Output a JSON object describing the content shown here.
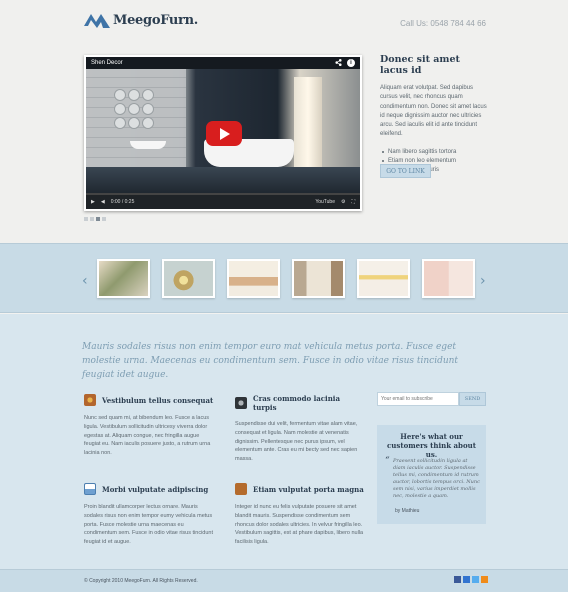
{
  "header": {
    "brand": "MeegoFurn.",
    "call_label": "Call Us:",
    "phone": "0548 784 44 66"
  },
  "video": {
    "title": "Shen Decor",
    "time_current": "0:00",
    "time_total": "0:25",
    "progress": 0,
    "controls": {
      "play": "▶",
      "volume": "◀",
      "youtube": "YouTube",
      "settings": "⚙",
      "fullscreen": "⛶",
      "share": "share-icon",
      "info": "i"
    }
  },
  "slider": {
    "total": 4,
    "active": 2
  },
  "intro": {
    "title": "Donec sit amet lacus id",
    "text": "Aliquam erat volutpat. Sed dapibus cursus velit, nec rhoncus quam condimentum non. Donec sit amet lacus id neque dignissim auctor nec ultricies arcu. Sed iaculis elit id ante tincidunt eleifend.",
    "bullets": [
      "Nam libero sagittis tortora",
      "Etiam non leo elementum",
      "Curabitur at mauris"
    ],
    "button": "GO TO LINK"
  },
  "gallery": {
    "prev": "‹",
    "next": "›",
    "thumbs": [
      "thumb-1",
      "thumb-2",
      "thumb-3",
      "thumb-4",
      "thumb-5",
      "thumb-6"
    ]
  },
  "quote": "Mauris sodales risus non enim tempor euro mat vehicula metus porta. Fusce eget molestie urna. Maecenas eu condimentum sem. Fusce in odio vitae risus tincidunt feugiat idet augue.",
  "features": [
    {
      "title": "Vestibulum tellus consequat",
      "text": "Nunc sed quam mi, at bibendum leo. Fusce a lacus ligula. Vestibulum sollicitudin ultricesy viverra dolor egestas at. Aliquam congue, nec fringilla augue feugiat eu. Nam iaculis posuere justo, a rutrum urna lacinia non.",
      "icon": "palette-icon"
    },
    {
      "title": "Cras commodo lacinia turpis",
      "text": "Suspendisse dui velit, fermentum vitae alam vitae, consequat et ligula. Nam molestie at venenatis dignissim. Pellentesque nec purus ipsum, vel elementum ante. Cras eu mi becty sed nec sapien massa.",
      "icon": "camera-icon"
    },
    {
      "title": "Morbi vulputate adipiscing",
      "text": "Proin blandit ullamcorper lectus ornare. Mauris sodales risus non enim tempor eumy vehicula metus porta. Fusce molestie urna maecenas eu condimentum sem. Fusce in odio vitae risus tincidunt feugiat id et augue.",
      "icon": "document-icon"
    },
    {
      "title": "Etiam vulputat porta magna",
      "text": "Integer id nunc eu felis vulputate posuere sit amet blandit mauris. Suspendisse condimentum sem rhoncus dolor sodales ultricies. In velvur fringilla leo. Vestibulum sagittis, est at phare dapibus, libero nulla facilisis ligula.",
      "icon": "briefcase-icon"
    }
  ],
  "newsletter": {
    "placeholder": "Your email to subscribe",
    "button": "SEND"
  },
  "testimonial": {
    "title": "Here's what our customers think about us.",
    "text": "Praesent sollicitudin ligula at diam iaculis auctor. Suspendisse tellus mi, condimentum id rutrum auctor, lobortis tempus orci. Nunc sem nisi, varius imperdiet mollis nec, molestie a quam.",
    "author": "by Mathieu"
  },
  "footer": {
    "copyright": "© Copyright 2010 MeegoFurn. All Rights Reserved.",
    "social": [
      "facebook-icon",
      "delicious-icon",
      "twitter-icon",
      "rss-icon"
    ]
  },
  "colors": {
    "accent": "#c7dbe8",
    "text_dark": "#2c3e50",
    "link": "#7d9db2",
    "youtube_red": "#d81e1e"
  }
}
